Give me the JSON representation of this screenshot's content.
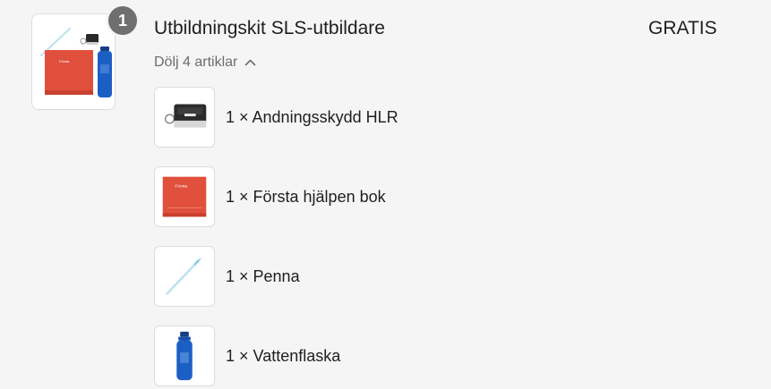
{
  "bundle": {
    "quantity": "1",
    "title": "Utbildningskit SLS-utbildare",
    "price": "GRATIS",
    "toggle_label": "Dölj 4 artiklar",
    "image_icon": "training-kit-image"
  },
  "components": [
    {
      "label": "1 × Andningsskydd HLR",
      "icon": "cpr-mask-keychain-image"
    },
    {
      "label": "1 × Första hjälpen bok",
      "icon": "first-aid-book-image"
    },
    {
      "label": "1 × Penna",
      "icon": "pen-image"
    },
    {
      "label": "1 × Vattenflaska",
      "icon": "water-bottle-image"
    }
  ],
  "colors": {
    "background": "#f5f5f5",
    "badge": "#6f6f6f",
    "book_red": "#e0503c",
    "bottle_blue": "#1c5fc4",
    "muted_text": "#6c6c6c"
  }
}
